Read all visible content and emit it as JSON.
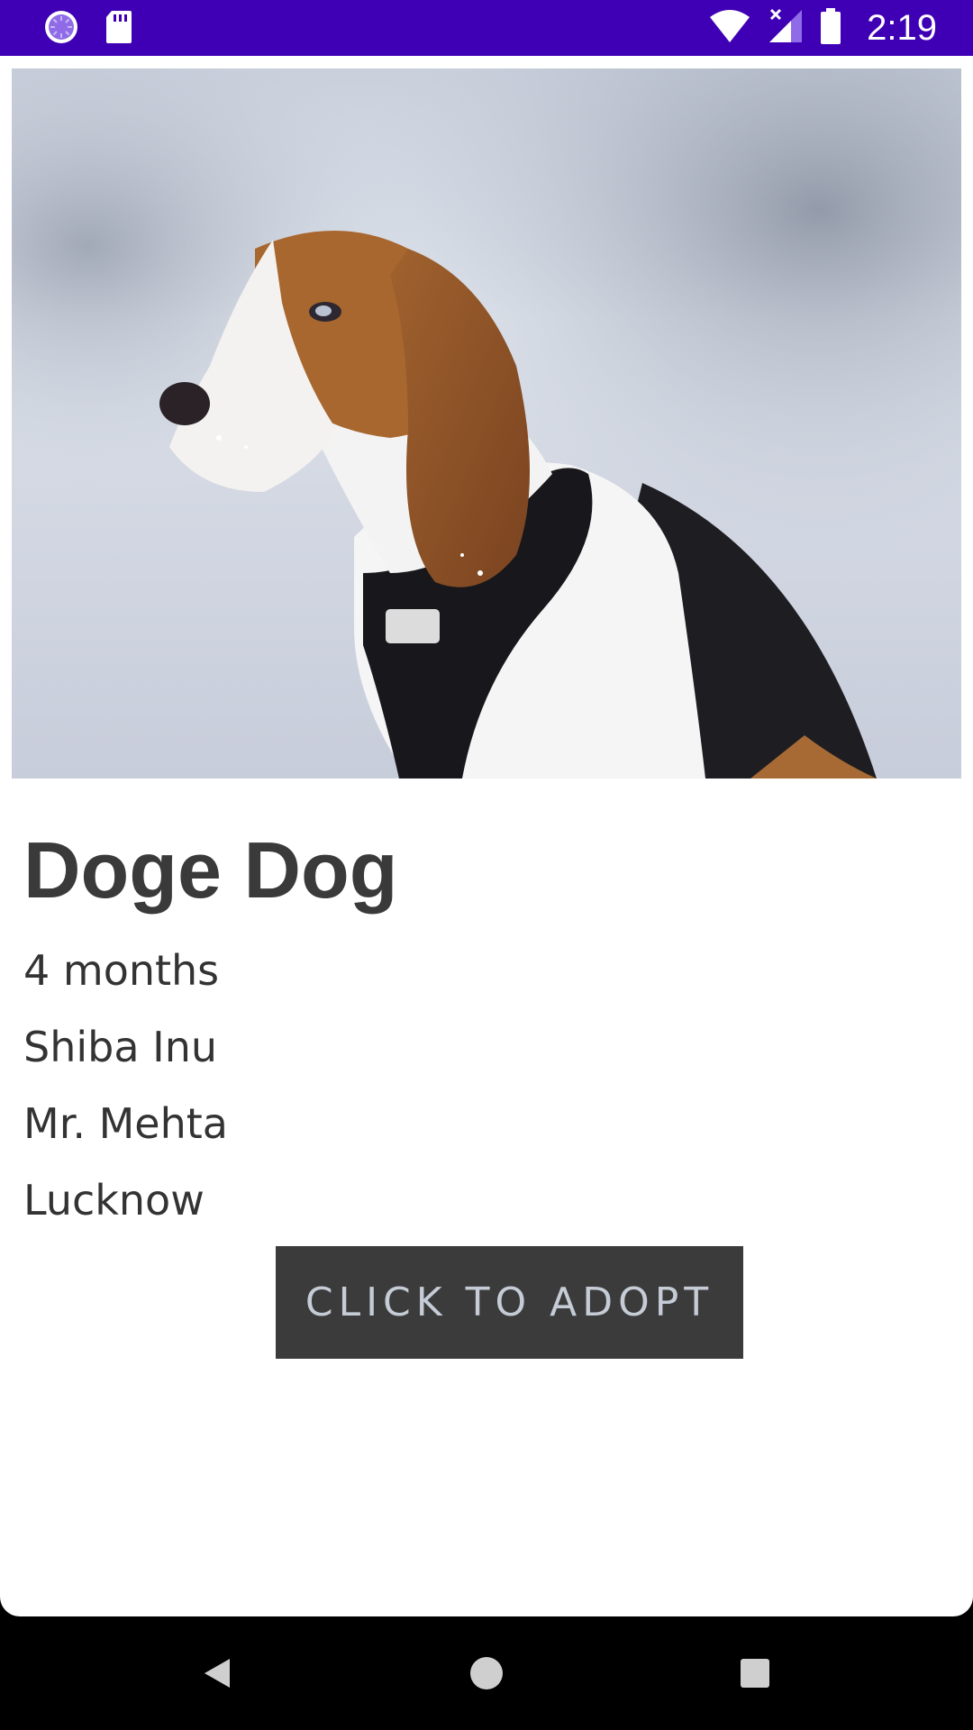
{
  "status_bar": {
    "time": "2:19",
    "background": "#3f00b5",
    "icons": [
      "loading-circle-icon",
      "sd-card-icon",
      "wifi-icon",
      "signal-icon",
      "battery-icon"
    ]
  },
  "pet": {
    "photo_icon": "beagle-photo",
    "name": "Doge Dog",
    "age": "4 months",
    "breed": "Shiba Inu",
    "owner": "Mr. Mehta",
    "location": "Lucknow"
  },
  "adopt_button": {
    "label": "CLICK TO ADOPT",
    "background": "#3b3b3b",
    "text_color": "#c5ccd6"
  },
  "nav_bar": {
    "icons": [
      "back-icon",
      "home-icon",
      "recents-icon"
    ]
  }
}
